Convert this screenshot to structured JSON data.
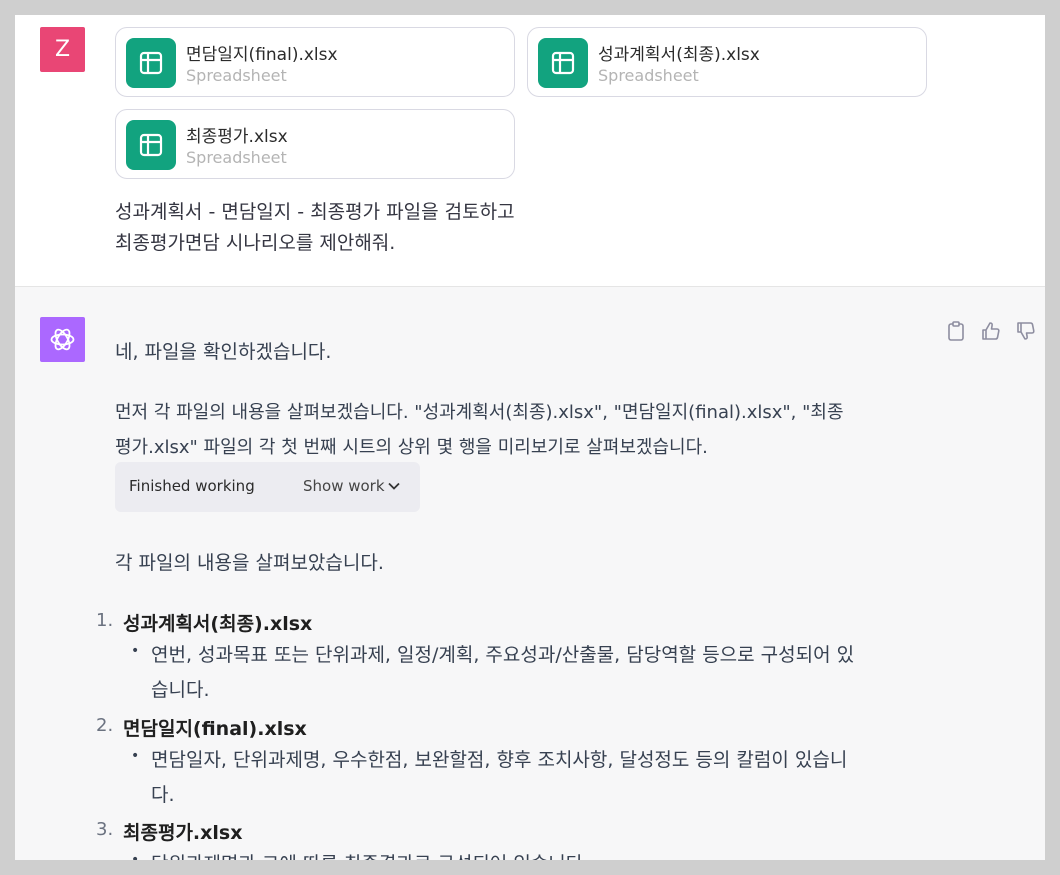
{
  "user": {
    "avatar_letter": "Z",
    "attachments": [
      {
        "name": "면담일지(final).xlsx",
        "type": "Spreadsheet"
      },
      {
        "name": "성과계획서(최종).xlsx",
        "type": "Spreadsheet"
      },
      {
        "name": "최종평가.xlsx",
        "type": "Spreadsheet"
      }
    ],
    "message_lines": [
      "성과계획서 - 면담일지 - 최종평가 파일을 검토하고",
      "최종평가면담 시나리오를 제안해줘."
    ]
  },
  "assistant": {
    "intro": "네, 파일을 확인하겠습니다.",
    "para_lines": [
      "먼저 각 파일의 내용을 살펴보겠습니다. \"성과계획서(최종).xlsx\", \"면담일지(final).xlsx\", \"최종",
      "평가.xlsx\" 파일의 각 첫 번째 시트의 상위 몇 행을 미리보기로 살펴보겠습니다."
    ],
    "tool": {
      "status": "Finished working",
      "toggle_label": "Show work"
    },
    "summary": "각 파일의 내용을 살펴보았습니다.",
    "list": [
      {
        "num": "1.",
        "title": "성과계획서(최종).xlsx",
        "sub_lines": [
          "연번, 성과목표 또는 단위과제, 일정/계획, 주요성과/산출물, 담당역할 등으로 구성되어 있",
          "습니다."
        ]
      },
      {
        "num": "2.",
        "title": "면담일지(final).xlsx",
        "sub_lines": [
          "면담일자, 단위과제명, 우수한점, 보완할점, 향후 조치사항, 달성정도 등의 칼럼이 있습니",
          "다."
        ]
      },
      {
        "num": "3.",
        "title": "최종평가.xlsx",
        "sub_lines": [
          "단위과제명과 그에 따른 최종결과로 구성되어 있습니다."
        ]
      }
    ]
  },
  "icons": {
    "spreadsheet": "spreadsheet-icon",
    "assistant_logo": "openai-logo-icon",
    "copy": "clipboard-icon",
    "thumbs_up": "thumbs-up-icon",
    "thumbs_down": "thumbs-down-icon",
    "chevron": "chevron-down-icon"
  },
  "colors": {
    "user_avatar": "#e94675",
    "assistant_avatar": "#ab68ff",
    "spreadsheet_icon": "#12a37f",
    "assistant_bg": "#f7f7f8"
  }
}
